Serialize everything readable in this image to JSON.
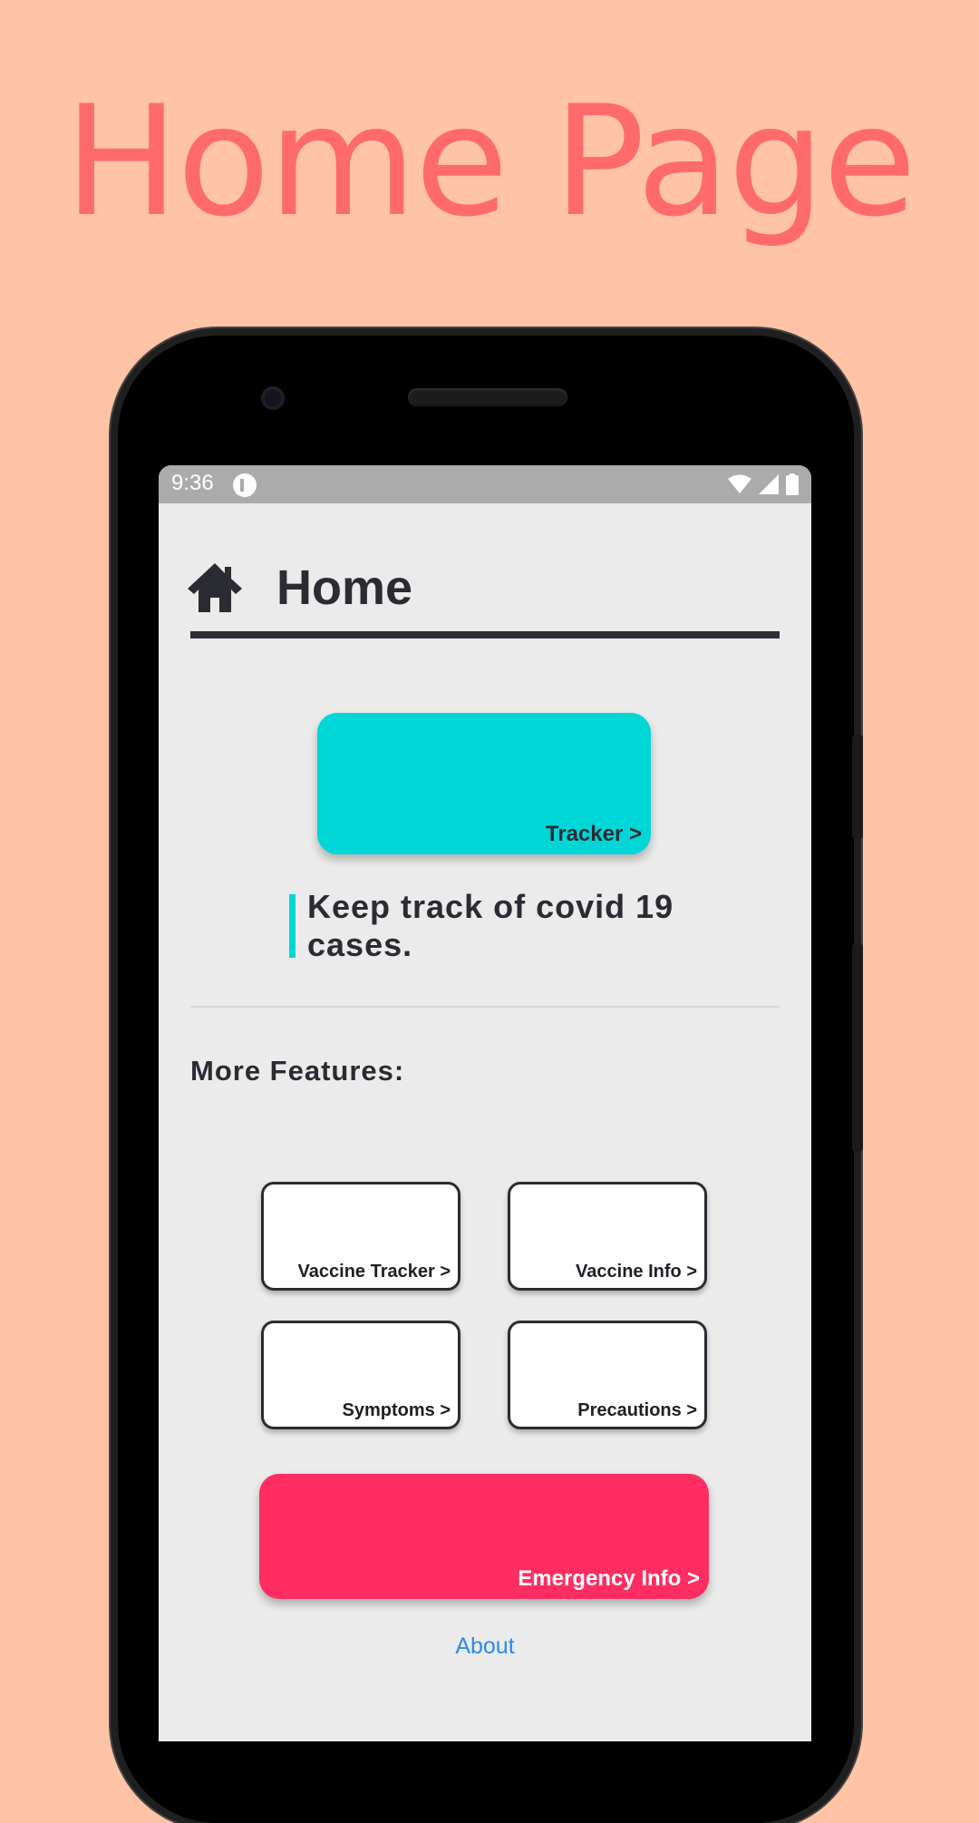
{
  "page": {
    "headline": "Home Page",
    "background_color": "#ffc4a6",
    "headline_color": "#ff6b6b"
  },
  "statusbar": {
    "time": "9:36",
    "icons": [
      "app-notification-icon",
      "wifi-icon",
      "signal-icon",
      "battery-icon"
    ]
  },
  "app": {
    "title": "Home",
    "title_icon": "home-icon",
    "tracker": {
      "label": "Tracker >",
      "color": "#00d6d6"
    },
    "tagline": "Keep track of covid 19 cases.",
    "section_title": "More Features:",
    "features": [
      {
        "label": "Vaccine Tracker >"
      },
      {
        "label": "Vaccine Info >"
      },
      {
        "label": "Symptoms >"
      },
      {
        "label": "Precautions >"
      }
    ],
    "emergency": {
      "label": "Emergency Info >",
      "color": "#ff2d61"
    },
    "about_link": "About"
  }
}
